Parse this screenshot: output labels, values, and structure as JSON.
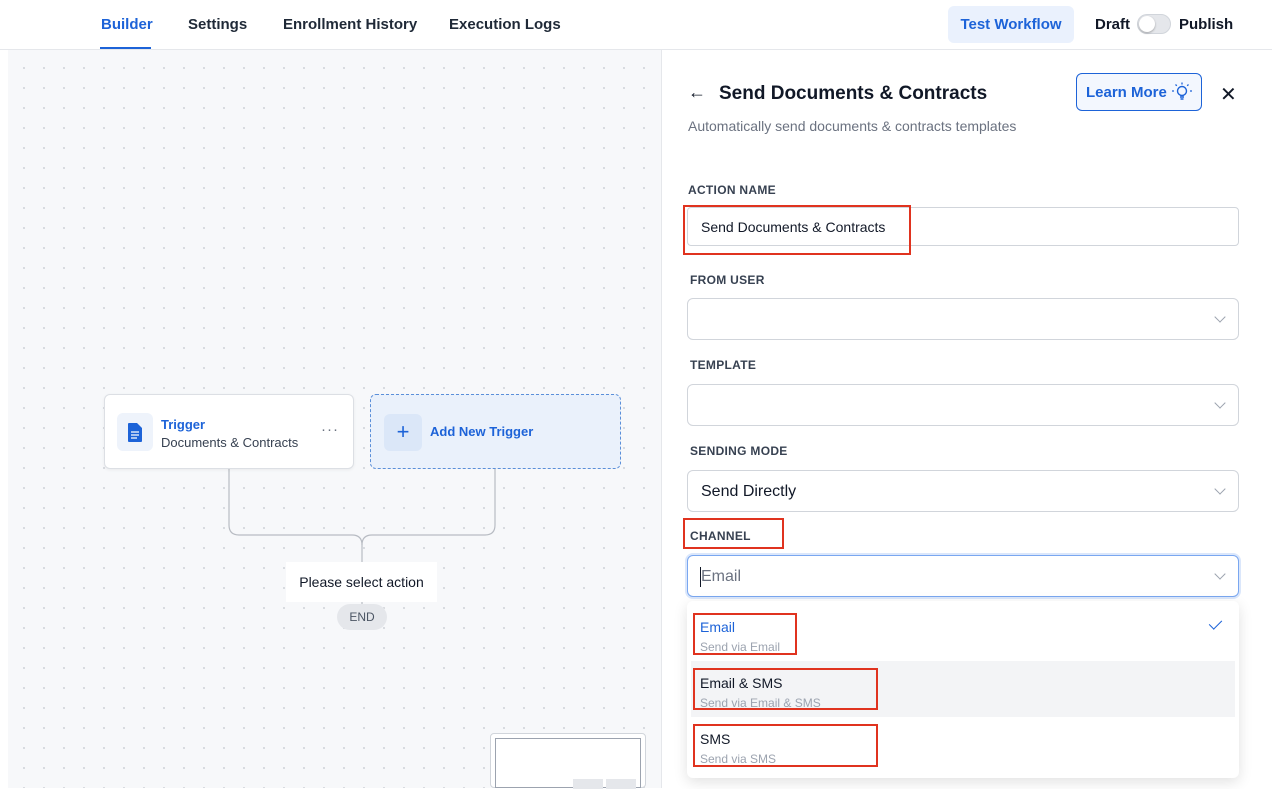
{
  "nav": {
    "tabs": [
      {
        "label": "Builder",
        "active": true
      },
      {
        "label": "Settings"
      },
      {
        "label": "Enrollment History"
      },
      {
        "label": "Execution Logs"
      }
    ],
    "test_button": "Test Workflow",
    "draft_label": "Draft",
    "publish_label": "Publish",
    "publish_enabled": false
  },
  "canvas": {
    "trigger": {
      "title": "Trigger",
      "subtitle": "Documents & Contracts",
      "icon": "document-icon",
      "menu_icon": "more-horizontal-icon"
    },
    "add_trigger": {
      "label": "Add New Trigger",
      "icon": "plus-icon"
    },
    "select_action": "Please select action",
    "end_label": "END"
  },
  "panel": {
    "back_icon": "arrow-left-icon",
    "title": "Send Documents & Contracts",
    "learn_more": "Learn More",
    "learn_more_icon": "lightbulb-icon",
    "close_icon": "close-icon",
    "description": "Automatically send documents & contracts templates",
    "fields": {
      "action_name": {
        "label": "ACTION NAME",
        "value": "Send Documents & Contracts"
      },
      "from_user": {
        "label": "FROM USER",
        "value": ""
      },
      "template": {
        "label": "TEMPLATE",
        "value": ""
      },
      "sending_mode": {
        "label": "SENDING MODE",
        "value": "Send Directly"
      },
      "channel": {
        "label": "CHANNEL",
        "value": "Email"
      }
    },
    "channel_options": [
      {
        "title": "Email",
        "subtitle": "Send via Email",
        "selected": true
      },
      {
        "title": "Email & SMS",
        "subtitle": "Send via Email & SMS",
        "hovered": true
      },
      {
        "title": "SMS",
        "subtitle": "Send via SMS"
      }
    ]
  },
  "colors": {
    "accent": "#1d63d8",
    "highlight": "#e0331f"
  }
}
